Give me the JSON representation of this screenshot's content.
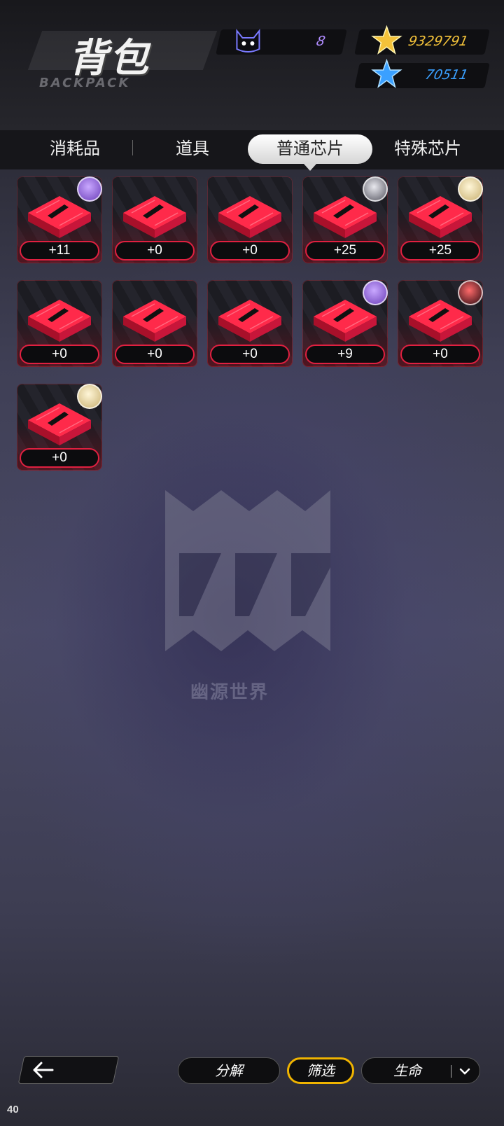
{
  "header": {
    "title": "背包",
    "subtitle": "BACKPACK",
    "resources": [
      {
        "icon": "cat-mask-icon",
        "value": "8",
        "color": "#b08cff"
      },
      {
        "icon": "gold-star-icon",
        "value": "9329791",
        "color": "#f3c23a"
      },
      {
        "icon": "blue-star-icon",
        "value": "70511",
        "color": "#3aa0ff"
      }
    ]
  },
  "tabs": [
    {
      "label": "消耗品",
      "active": false
    },
    {
      "label": "道具",
      "active": false
    },
    {
      "label": "普通芯片",
      "active": true
    },
    {
      "label": "特殊芯片",
      "active": false
    }
  ],
  "chips": [
    {
      "level": "+11",
      "avatar": "purple"
    },
    {
      "level": "+0",
      "avatar": ""
    },
    {
      "level": "+0",
      "avatar": ""
    },
    {
      "level": "+25",
      "avatar": "grey"
    },
    {
      "level": "+25",
      "avatar": "blonde"
    },
    {
      "level": "+0",
      "avatar": ""
    },
    {
      "level": "+0",
      "avatar": ""
    },
    {
      "level": "+0",
      "avatar": ""
    },
    {
      "level": "+9",
      "avatar": "purple"
    },
    {
      "level": "+0",
      "avatar": "red"
    },
    {
      "level": "+0",
      "avatar": "blonde"
    }
  ],
  "watermark_text": "幽源世界",
  "footer": {
    "decompose_label": "分解",
    "filter_label": "筛选",
    "sort_label": "生命"
  },
  "fps": "40",
  "colors": {
    "accent_red": "#e02040",
    "filter_border": "#f0b400"
  }
}
